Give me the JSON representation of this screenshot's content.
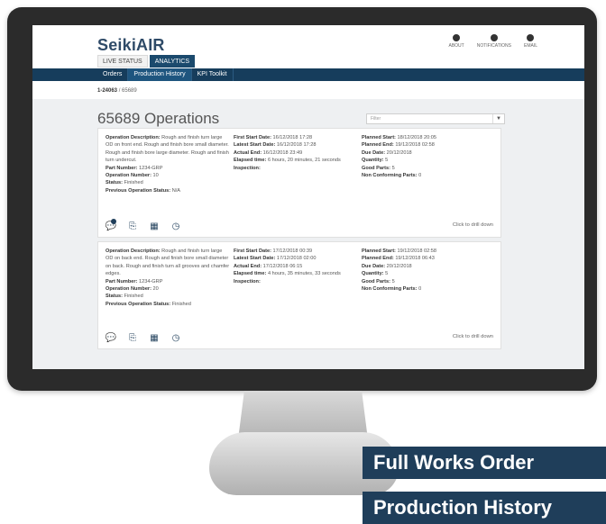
{
  "app": {
    "brand": "SeikiAIR",
    "header_icons": [
      {
        "name": "about",
        "label": "ABOUT"
      },
      {
        "name": "notifications",
        "label": "NOTIFICATIONS"
      },
      {
        "name": "email",
        "label": "EMAIL"
      }
    ],
    "top_tabs": [
      "LIVE STATUS",
      "ANALYTICS"
    ],
    "active_top_tab": "ANALYTICS",
    "subnav": [
      "Orders",
      "Production History",
      "KPI Toolkit"
    ],
    "active_subnav": "Production History"
  },
  "breadcrumb": {
    "parent": "1-24063",
    "current": "65689"
  },
  "page": {
    "title": "65689 Operations",
    "filter": {
      "placeholder": "Filter"
    }
  },
  "cards": [
    {
      "col1": {
        "operation_description": "Rough and finish turn large OD on front end. Rough and finish bore small diameter. Rough and finish bore large diameter. Rough and finish turn undercut.",
        "part_number": "1234-GRP",
        "operation_number": "10",
        "status": "Finished",
        "previous_operation_status": "N/A"
      },
      "col2": {
        "first_start_date": "16/12/2018 17:28",
        "latest_start_date": "16/12/2018 17:28",
        "actual_end": "16/12/2018 23:49",
        "elapsed_time": "6 hours, 20 minutes, 21 seconds",
        "inspection": ""
      },
      "col3": {
        "planned_start": "18/12/2018 20:05",
        "planned_end": "19/12/2018 02:58",
        "due_date": "20/12/2018",
        "quantity": "5",
        "good_parts": "5",
        "non_conforming_parts": "0"
      },
      "drill": "Click to drill down"
    },
    {
      "col1": {
        "operation_description": "Rough and finish turn large OD on back end. Rough and finish bore small diameter on back. Rough and finish turn all grooves and chamfer edges.",
        "part_number": "1234-GRP",
        "operation_number": "20",
        "status": "Finished",
        "previous_operation_status": "Finished"
      },
      "col2": {
        "first_start_date": "17/12/2018 00:39",
        "latest_start_date": "17/12/2018 02:00",
        "actual_end": "17/12/2018 06:15",
        "elapsed_time": "4 hours, 35 minutes, 33 seconds",
        "inspection": ""
      },
      "col3": {
        "planned_start": "19/12/2018 02:58",
        "planned_end": "19/12/2018 06:43",
        "due_date": "20/12/2018",
        "quantity": "5",
        "good_parts": "5",
        "non_conforming_parts": "0"
      },
      "drill": "Click to drill down"
    }
  ],
  "labels": {
    "operation_description": "Operation Description:",
    "part_number": "Part Number:",
    "operation_number": "Operation Number:",
    "status": "Status:",
    "previous_operation_status": "Previous Operation Status:",
    "first_start_date": "First Start Date:",
    "latest_start_date": "Latest Start Date:",
    "actual_end": "Actual End:",
    "elapsed_time": "Elapsed time:",
    "inspection": "Inspection:",
    "planned_start": "Planned Start:",
    "planned_end": "Planned End:",
    "due_date": "Due Date:",
    "quantity": "Quantity:",
    "good_parts": "Good Parts:",
    "non_conforming_parts": "Non Conforming Parts:"
  },
  "banners": [
    "Full Works Order",
    "Production History"
  ]
}
